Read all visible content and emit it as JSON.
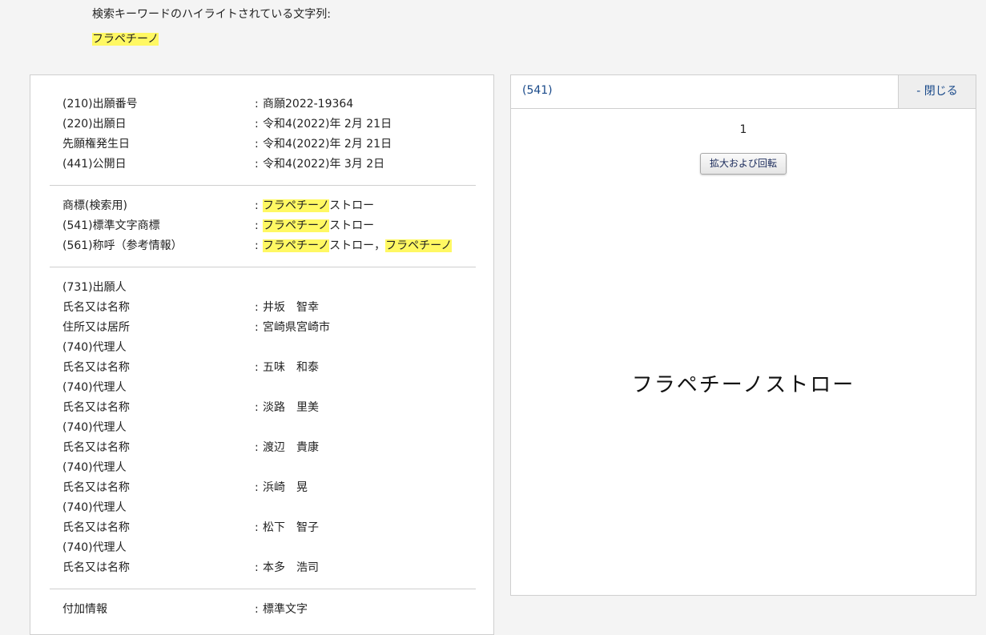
{
  "header": {
    "caption": "検索キーワードのハイライトされている文字列:",
    "keyword": "フラペチーノ"
  },
  "details": {
    "application_info": [
      {
        "label": "(210)出願番号",
        "value": "商願2022-19364"
      },
      {
        "label": "(220)出願日",
        "value": "令和4(2022)年 2月 21日"
      },
      {
        "label": "先願権発生日",
        "value": "令和4(2022)年 2月 21日"
      },
      {
        "label": "(441)公開日",
        "value": "令和4(2022)年 3月 2日"
      }
    ],
    "trademark_info": [
      {
        "label": "商標(検索用)",
        "value_hl": "フラペチーノ",
        "value_rest": "ストロー"
      },
      {
        "label": "(541)標準文字商標",
        "value_hl": "フラペチーノ",
        "value_rest": "ストロー"
      },
      {
        "label": "(561)称呼（参考情報）",
        "value_hl": "フラペチーノ",
        "value_rest": "ストロー，",
        "value_hl2": "フラペチーノ"
      }
    ],
    "parties": [
      {
        "label": "(731)出願人",
        "value": ""
      },
      {
        "label": "氏名又は名称",
        "value": "井坂　智幸"
      },
      {
        "label": "住所又は居所",
        "value": "宮崎県宮崎市"
      },
      {
        "label": "(740)代理人",
        "value": ""
      },
      {
        "label": "氏名又は名称",
        "value": "五味　和泰"
      },
      {
        "label": "(740)代理人",
        "value": ""
      },
      {
        "label": "氏名又は名称",
        "value": "淡路　里美"
      },
      {
        "label": "(740)代理人",
        "value": ""
      },
      {
        "label": "氏名又は名称",
        "value": "渡辺　貴康"
      },
      {
        "label": "(740)代理人",
        "value": ""
      },
      {
        "label": "氏名又は名称",
        "value": "浜崎　晃"
      },
      {
        "label": "(740)代理人",
        "value": ""
      },
      {
        "label": "氏名又は名称",
        "value": "松下　智子"
      },
      {
        "label": "(740)代理人",
        "value": ""
      },
      {
        "label": "氏名又は名称",
        "value": "本多　浩司"
      }
    ],
    "additional_info": [
      {
        "label": "付加情報",
        "value": "標準文字"
      }
    ]
  },
  "image_panel": {
    "title": "(541)",
    "close_label": "- 閉じる",
    "image_index": "1",
    "zoom_label": "拡大および回転",
    "mark_text": "フラペチーノストロー"
  },
  "colors": {
    "highlight": "#fff863",
    "link": "#1a4a8a"
  }
}
